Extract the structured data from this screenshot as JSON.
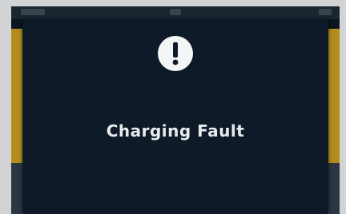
{
  "alert": {
    "icon": "exclamation-circle-icon",
    "title": "Charging Fault"
  },
  "colors": {
    "background": "#d2d3d5",
    "modal": "#0e1a27",
    "text": "#e9ecef",
    "underlying_accent": "#b48e1d"
  }
}
